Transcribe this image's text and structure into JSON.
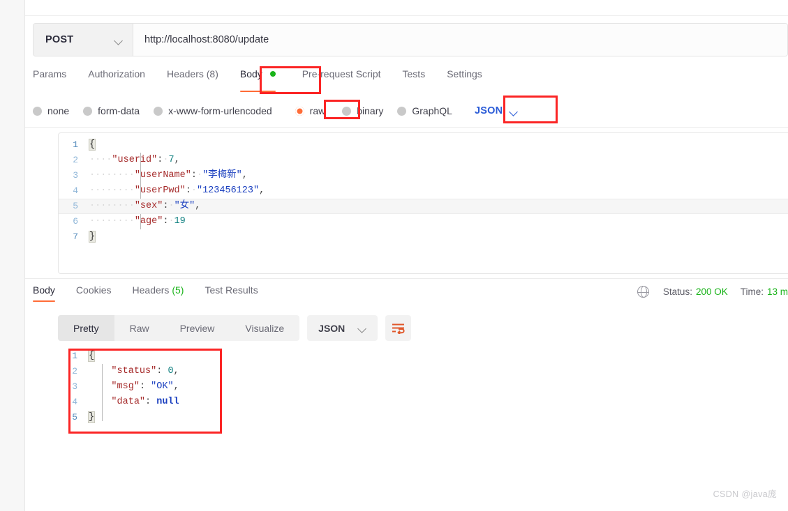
{
  "request": {
    "method": "POST",
    "url": "http://localhost:8080/update",
    "tabs": [
      {
        "label": "Params",
        "active": false
      },
      {
        "label": "Authorization",
        "active": false
      },
      {
        "label": "Headers (8)",
        "active": false
      },
      {
        "label": "Body",
        "active": true,
        "dot": true
      },
      {
        "label": "Pre-request Script",
        "active": false
      },
      {
        "label": "Tests",
        "active": false
      },
      {
        "label": "Settings",
        "active": false
      }
    ],
    "body_types": [
      {
        "label": "none",
        "selected": false
      },
      {
        "label": "form-data",
        "selected": false
      },
      {
        "label": "x-www-form-urlencoded",
        "selected": false
      },
      {
        "label": "raw",
        "selected": true
      },
      {
        "label": "binary",
        "selected": false
      },
      {
        "label": "GraphQL",
        "selected": false
      }
    ],
    "format_select": "JSON",
    "body_lines": [
      {
        "num": "1",
        "text": "{",
        "type": "open-brace"
      },
      {
        "num": "2",
        "key": "userid",
        "value": "7",
        "value_type": "number",
        "indent": 4,
        "comma": true
      },
      {
        "num": "3",
        "key": "userName",
        "value": "李梅新",
        "value_type": "string",
        "indent": 8,
        "comma": true
      },
      {
        "num": "4",
        "key": "userPwd",
        "value": "123456123",
        "value_type": "string",
        "indent": 8,
        "comma": true
      },
      {
        "num": "5",
        "key": "sex",
        "value": "女",
        "value_type": "string",
        "indent": 8,
        "comma": true,
        "active": true
      },
      {
        "num": "6",
        "key": "age",
        "value": "19",
        "value_type": "number",
        "indent": 8,
        "comma": false
      },
      {
        "num": "7",
        "text": "}",
        "type": "close-brace"
      }
    ]
  },
  "response": {
    "tabs": [
      {
        "label": "Body",
        "active": true
      },
      {
        "label": "Cookies",
        "active": false
      },
      {
        "label": "Headers",
        "count": "(5)",
        "active": false
      },
      {
        "label": "Test Results",
        "active": false
      }
    ],
    "status_label": "Status:",
    "status_value": "200 OK",
    "time_label": "Time:",
    "time_value": "13 m",
    "view_modes": [
      {
        "label": "Pretty",
        "active": true
      },
      {
        "label": "Raw",
        "active": false
      },
      {
        "label": "Preview",
        "active": false
      },
      {
        "label": "Visualize",
        "active": false
      }
    ],
    "format_select": "JSON",
    "body_lines": [
      {
        "num": "1",
        "text": "{",
        "type": "open-brace"
      },
      {
        "num": "2",
        "key": "status",
        "value": "0",
        "value_type": "number",
        "indent": 4,
        "comma": true
      },
      {
        "num": "3",
        "key": "msg",
        "value": "OK",
        "value_type": "string",
        "indent": 4,
        "comma": true
      },
      {
        "num": "4",
        "key": "data",
        "value": "null",
        "value_type": "null",
        "indent": 4,
        "comma": false
      },
      {
        "num": "5",
        "text": "}",
        "type": "close-brace"
      }
    ]
  },
  "annotations": [
    {
      "name": "body-tab-highlight"
    },
    {
      "name": "raw-radio-highlight"
    },
    {
      "name": "json-select-highlight"
    },
    {
      "name": "response-body-highlight"
    }
  ],
  "watermark": "CSDN @java庞",
  "colors": {
    "accent": "#ff6c37",
    "annotation": "#fb2525",
    "success": "#19b319",
    "link": "#2a5bd7"
  }
}
